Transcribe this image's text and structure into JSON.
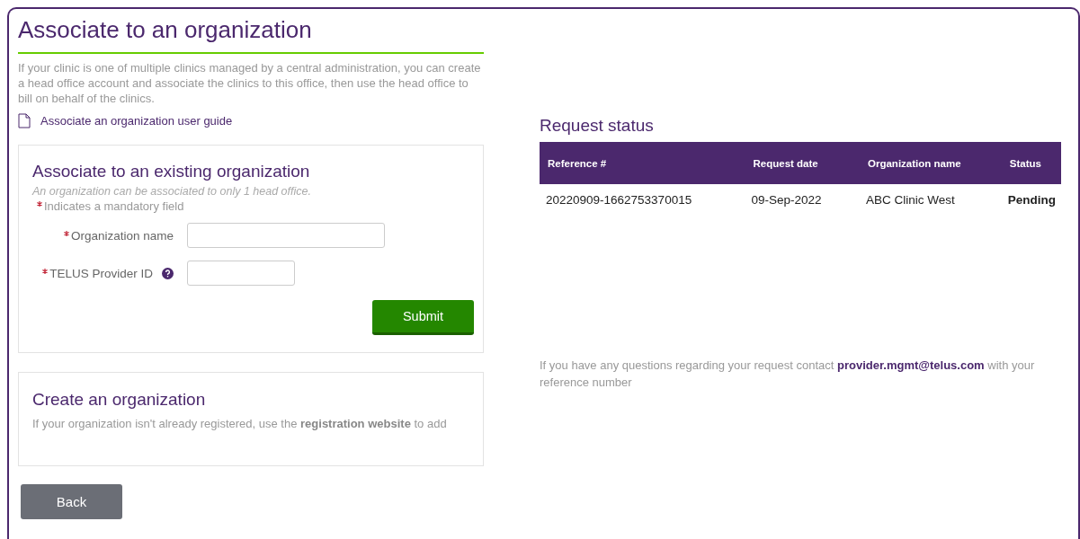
{
  "title": "Associate to an organization",
  "intro": "If your clinic is one of multiple clinics managed by a central administration, you can create a head office account and associate the clinics to this office, then use the head office to bill on behalf of the clinics.",
  "guide_link": "Associate an organization user guide",
  "existing": {
    "heading": "Associate to an existing organization",
    "note": "An organization can be associated to only 1 head office.",
    "mandatory_note": "Indicates a mandatory field",
    "fields": [
      {
        "label": "Organization name",
        "required": true,
        "help": false,
        "kind": "wide"
      },
      {
        "label": "TELUS Provider ID",
        "required": true,
        "help": true,
        "kind": "narrow"
      }
    ],
    "submit": "Submit"
  },
  "create": {
    "heading": "Create an organization",
    "text_before": "If your organization isn't already registered, use the ",
    "link": "registration website",
    "text_after": " to add"
  },
  "back": "Back",
  "request_status": {
    "heading": "Request status",
    "columns": [
      "Reference #",
      "Request date",
      "Organization name",
      "Status"
    ],
    "rows": [
      [
        "20220909-1662753370015",
        "09-Sep-2022",
        "ABC Clinic West",
        "Pending"
      ]
    ]
  },
  "contact": {
    "text_before": "If you have any questions regarding your request contact ",
    "email": "provider.mgmt@telus.com",
    "text_after": " with your reference number"
  }
}
